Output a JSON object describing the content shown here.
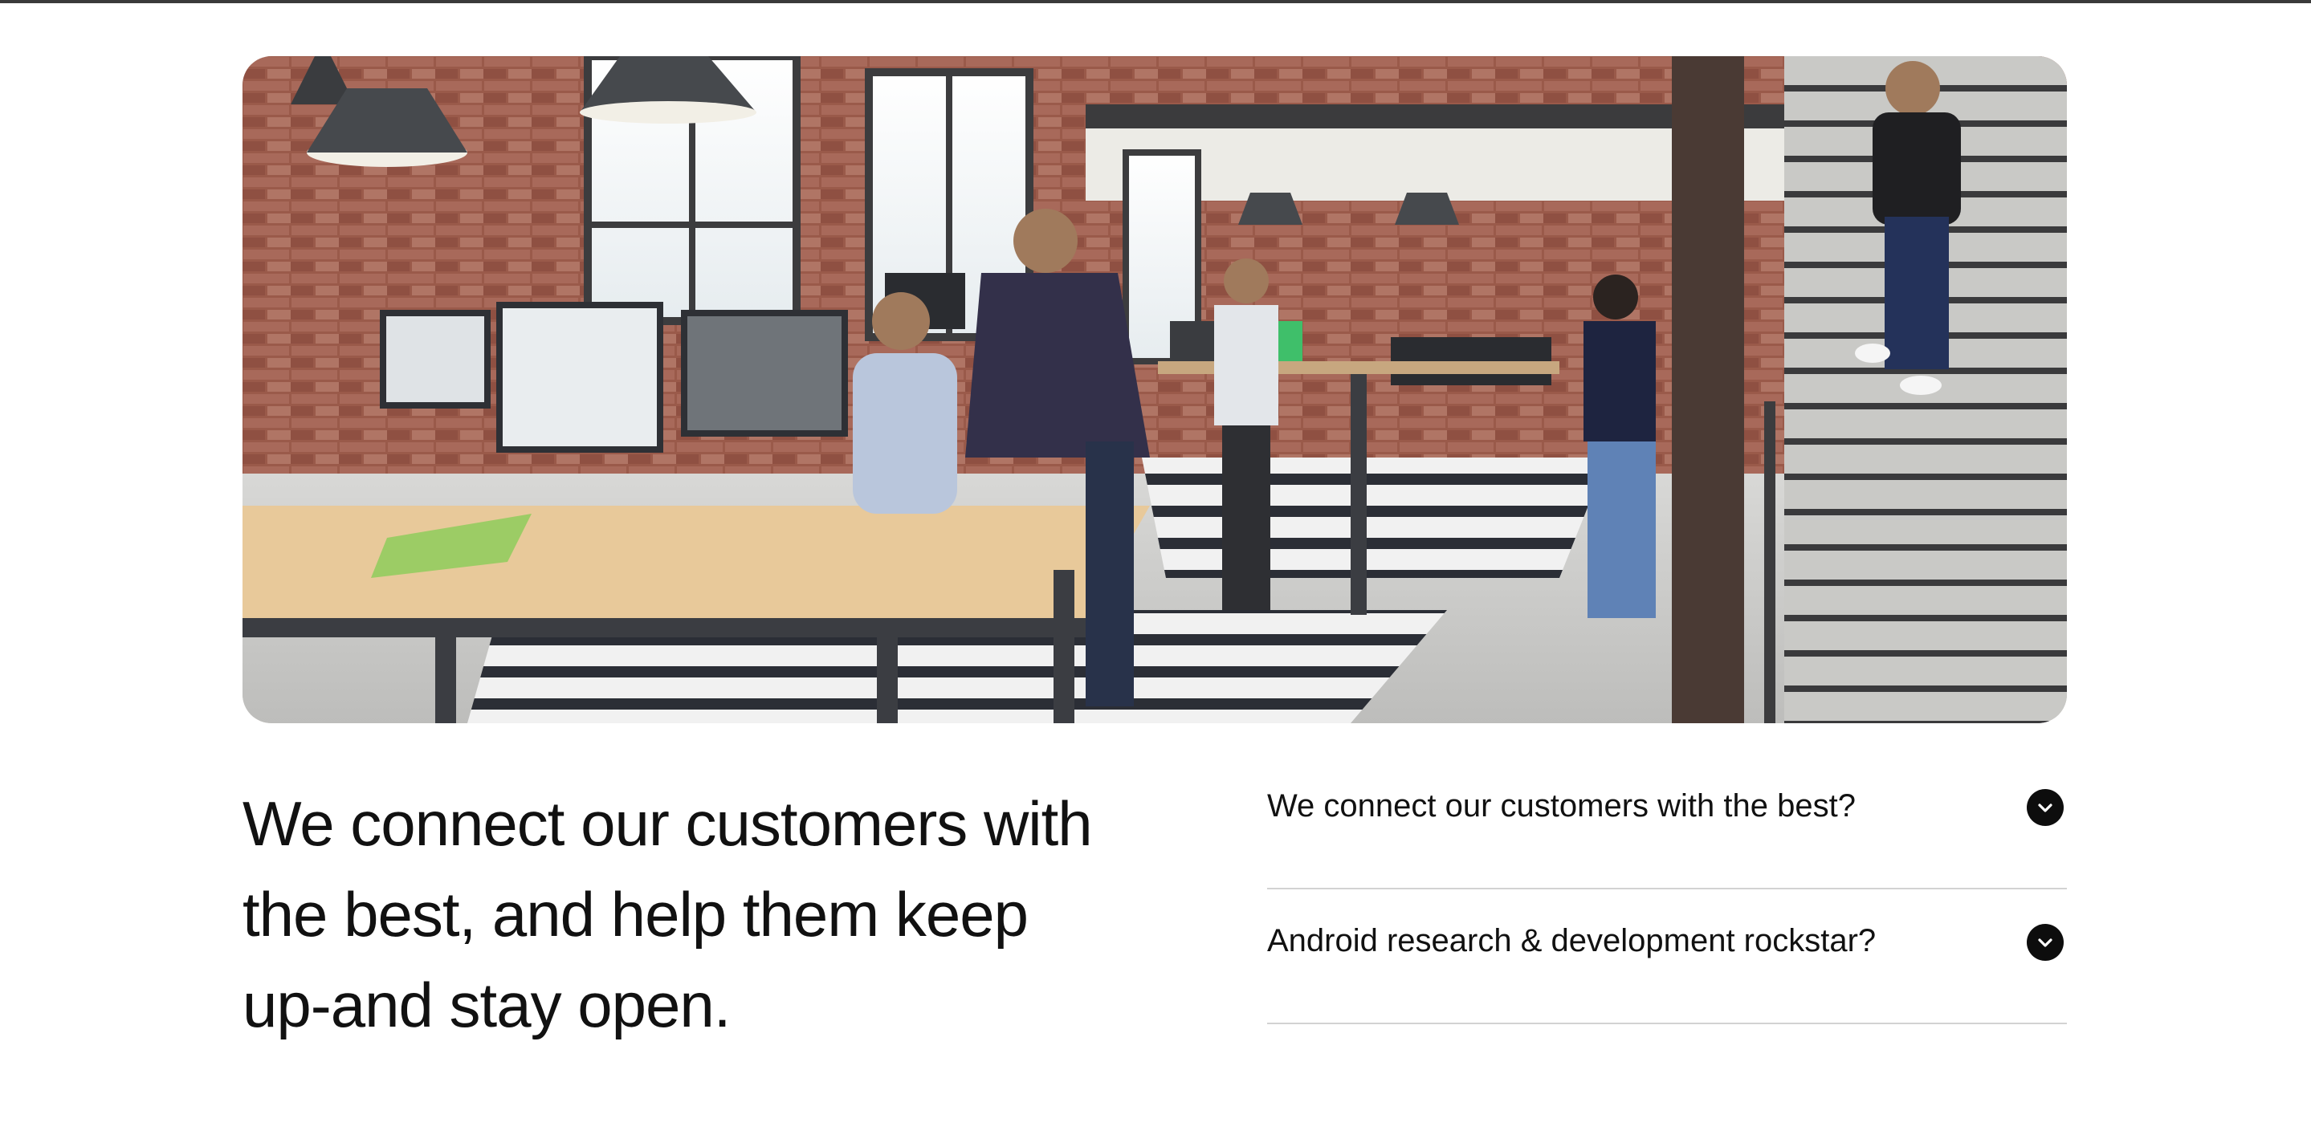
{
  "hero": {
    "image_alt": "Open-plan office with people working at desks and a staircase"
  },
  "headline": {
    "text": "We connect our customers with the best, and help them keep up-and stay open."
  },
  "faq": {
    "items": [
      {
        "question": "We connect our customers with the best?",
        "icon": "chevron-down-icon"
      },
      {
        "question": "Android research & development rockstar?",
        "icon": "chevron-down-icon"
      }
    ]
  },
  "colors": {
    "text": "#111111",
    "divider": "#d2d2d2",
    "toggle_bg": "#0d0d0d",
    "top_rule": "#3a3a3a"
  }
}
